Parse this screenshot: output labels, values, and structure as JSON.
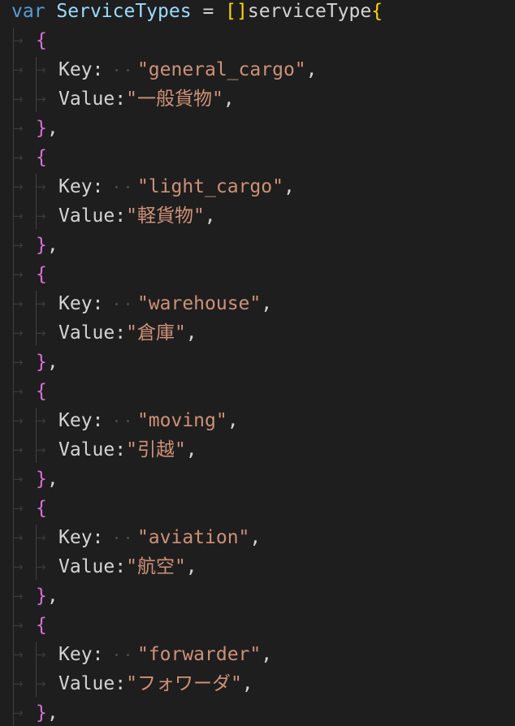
{
  "colors": {
    "keyword": "#569cd6",
    "identifier": "#9cdcfe",
    "bracket_level1": "#ffd700",
    "bracket_level2": "#da70d6",
    "string": "#ce9178",
    "text": "#d4d4d4",
    "background": "#1e1e1e"
  },
  "icons": {
    "whitespace_tab": "tab-arrow-icon"
  },
  "code": {
    "decl": {
      "keyword": "var",
      "name": "ServiceTypes",
      "equals": "=",
      "bracket": "[]",
      "type": "serviceType",
      "open_brace": "{"
    },
    "entries": [
      {
        "open": "{",
        "key_label": "Key:",
        "key": "\"general_cargo\"",
        "value_label": "Value:",
        "value": "\"一般貨物\"",
        "comma": ",",
        "close": "}",
        "close_comma": ","
      },
      {
        "open": "{",
        "key_label": "Key:",
        "key": "\"light_cargo\"",
        "value_label": "Value:",
        "value": "\"軽貨物\"",
        "comma": ",",
        "close": "}",
        "close_comma": ","
      },
      {
        "open": "{",
        "key_label": "Key:",
        "key": "\"warehouse\"",
        "value_label": "Value:",
        "value": "\"倉庫\"",
        "comma": ",",
        "close": "}",
        "close_comma": ","
      },
      {
        "open": "{",
        "key_label": "Key:",
        "key": "\"moving\"",
        "value_label": "Value:",
        "value": "\"引越\"",
        "comma": ",",
        "close": "}",
        "close_comma": ","
      },
      {
        "open": "{",
        "key_label": "Key:",
        "key": "\"aviation\"",
        "value_label": "Value:",
        "value": "\"航空\"",
        "comma": ",",
        "close": "}",
        "close_comma": ","
      },
      {
        "open": "{",
        "key_label": "Key:",
        "key": "\"forwarder\"",
        "value_label": "Value:",
        "value": "\"フォワーダ\"",
        "comma": ",",
        "close": "}",
        "close_comma": ","
      }
    ]
  }
}
